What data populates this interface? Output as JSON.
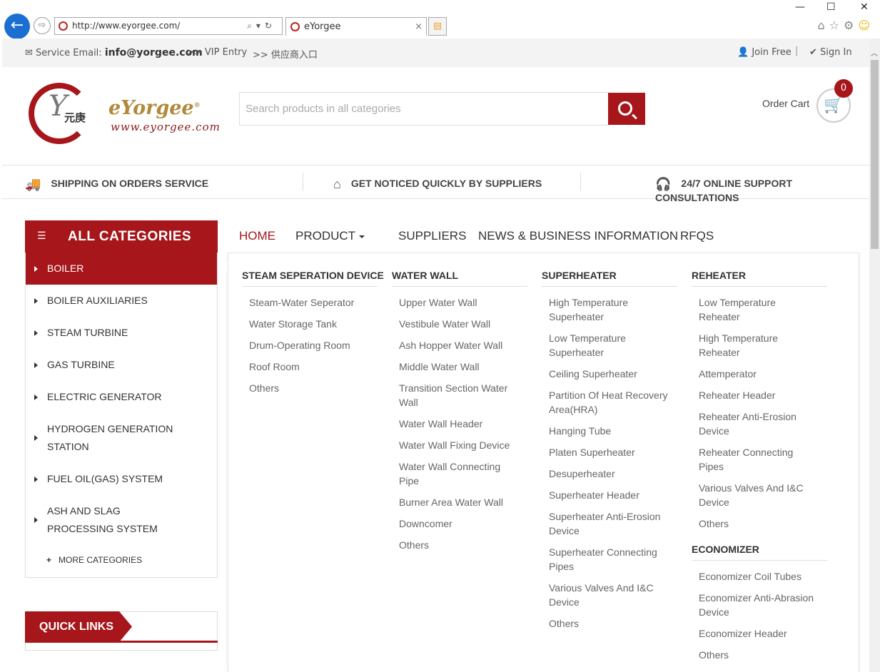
{
  "browser": {
    "url": "http://www.eyorgee.com/",
    "tab_title": "eYorgee",
    "tab_close": "×",
    "back_glyph": "←",
    "forward_glyph": "⇨",
    "address_tools": "⌕▾↻",
    "newtab_glyph": "▤",
    "minimize": "—",
    "maximize": "☐",
    "close": "✕",
    "home_glyph": "⌂",
    "star_glyph": "☆",
    "gear_glyph": "⚙",
    "smile_glyph": "☺"
  },
  "topbar": {
    "service_label": "Service Email:",
    "service_email": "info@yorgee.com",
    "vip_entry": ">> VIP Entry",
    "supplier_entry": ">> 供应商入口",
    "join_free": "Join Free",
    "sign_in": "Sign In",
    "join_icon": "person-icon",
    "signin_icon": "check-icon"
  },
  "header": {
    "logo_cn": "元庚",
    "brand": "eYorgee",
    "brand_mark": "®",
    "brand_url": "www.eyorgee.com",
    "search_placeholder": "Search products in all categories",
    "cart_label": "Order Cart",
    "cart_count": "0"
  },
  "features": [
    {
      "icon": "truck-icon",
      "glyph": "🚚",
      "label": "SHIPPING ON ORDERS SERVICE"
    },
    {
      "icon": "home-icon",
      "glyph": "⌂",
      "label": "GET NOTICED QUICKLY BY SUPPLIERS"
    },
    {
      "icon": "headphones-icon",
      "glyph": "🎧",
      "label": "24/7 ONLINE SUPPORT CONSULTATIONS"
    }
  ],
  "categories": {
    "title": "ALL CATEGORIES",
    "items": [
      "BOILER",
      "BOILER AUXILIARIES",
      "STEAM TURBINE",
      "GAS TURBINE",
      "ELECTRIC GENERATOR",
      "HYDROGEN GENERATION STATION",
      "FUEL OIL(GAS) SYSTEM",
      "ASH AND SLAG PROCESSING SYSTEM"
    ],
    "more": "MORE CATEGORIES",
    "active_index": 0
  },
  "quick_links": {
    "title": "QUICK LINKS"
  },
  "nav": {
    "items": [
      "HOME",
      "PRODUCT",
      "SUPPLIERS",
      "NEWS & BUSINESS INFORMATION",
      "RFQS"
    ],
    "active_index": 0
  },
  "mega": {
    "columns": [
      {
        "head": "STEAM SEPERATION DEVICE",
        "links": [
          "Steam-Water Seperator",
          "Water Storage Tank",
          "Drum-Operating Room",
          "Roof Room",
          "Others"
        ]
      },
      {
        "head": "WATER WALL",
        "links": [
          "Upper Water Wall",
          "Vestibule Water Wall",
          "Ash Hopper Water Wall",
          "Middle Water Wall",
          "Transition Section Water Wall",
          "Water Wall Header",
          "Water Wall Fixing Device",
          "Water Wall Connecting Pipe",
          "Burner Area Water Wall",
          "Downcomer",
          "Others"
        ]
      },
      {
        "head": "SUPERHEATER",
        "links": [
          "High Temperature Superheater",
          "Low Temperature Superheater",
          "Ceiling Superheater",
          "Partition Of Heat Recovery Area(HRA)",
          "Hanging Tube",
          "Platen Superheater",
          "Desuperheater",
          "Superheater Header",
          "Superheater Anti-Erosion Device",
          "Superheater Connecting Pipes",
          "Various Valves And I&C Device",
          "Others"
        ]
      },
      {
        "head": "REHEATER",
        "links": [
          "Low Temperature Reheater",
          "High Temperature Reheater",
          "Attemperator",
          "Reheater Header",
          "Reheater Anti-Erosion Device",
          "Reheater Connecting Pipes",
          "Various Valves And I&C Device",
          "Others"
        ]
      },
      {
        "head": "ECONOMIZER",
        "links": [
          "Economizer Coil Tubes",
          "Economizer Anti-Abrasion Device",
          "Economizer Header",
          "Others"
        ]
      }
    ]
  }
}
